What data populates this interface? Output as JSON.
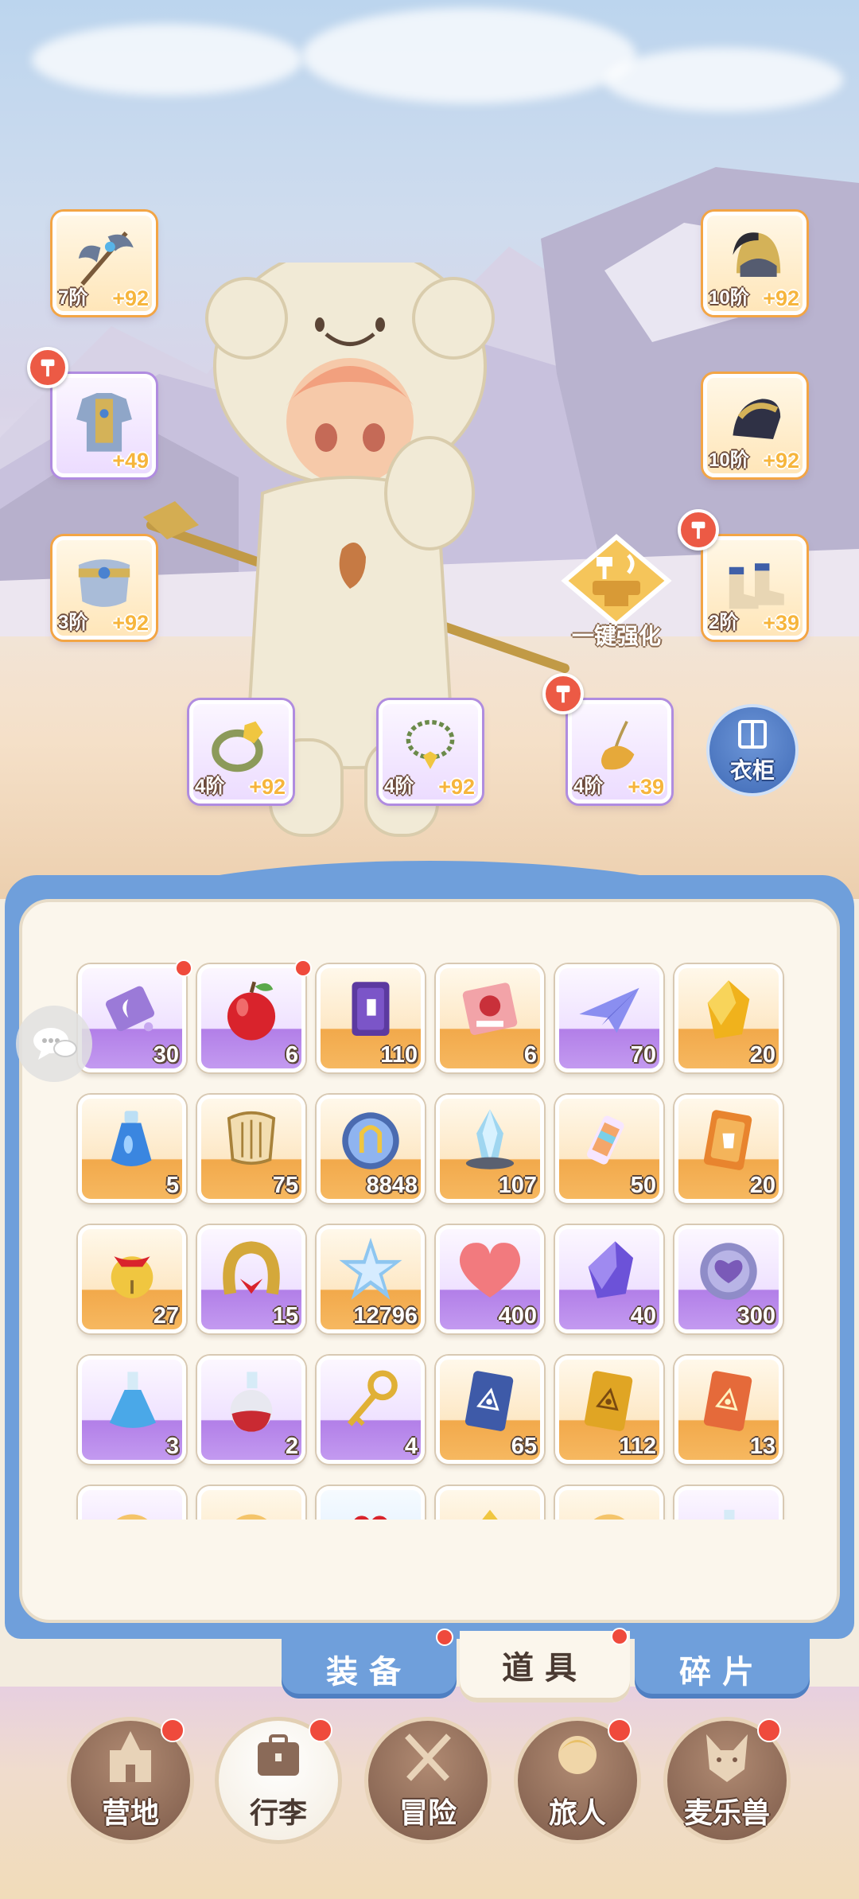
{
  "equipment": {
    "weapon": {
      "tier": "7阶",
      "bonus": "+92",
      "icon": "axe-icon"
    },
    "armor": {
      "tier": "",
      "bonus": "+49",
      "icon": "armor-icon"
    },
    "belt": {
      "tier": "3阶",
      "bonus": "+92",
      "icon": "belt-icon"
    },
    "helmet": {
      "tier": "10阶",
      "bonus": "+92",
      "icon": "helmet-icon"
    },
    "gloves": {
      "tier": "10阶",
      "bonus": "+92",
      "icon": "gauntlet-icon"
    },
    "boots": {
      "tier": "2阶",
      "bonus": "+39",
      "icon": "boots-icon"
    },
    "ring": {
      "tier": "4阶",
      "bonus": "+92",
      "icon": "ring-icon"
    },
    "necklace": {
      "tier": "4阶",
      "bonus": "+92",
      "icon": "necklace-icon"
    },
    "earring": {
      "tier": "4阶",
      "bonus": "+39",
      "icon": "earring-icon"
    }
  },
  "actions": {
    "upgrade_all": "一键强化",
    "wardrobe": "衣柜"
  },
  "inventory": {
    "rows": [
      [
        {
          "count": "30",
          "icon": "ticket-icon"
        },
        {
          "count": "6",
          "icon": "apple-icon"
        },
        {
          "count": "110",
          "icon": "purple-card-icon"
        },
        {
          "count": "6",
          "icon": "coupon-icon"
        },
        {
          "count": "70",
          "icon": "paper-plane-icon"
        },
        {
          "count": "20",
          "icon": "gold-gem-icon"
        }
      ],
      [
        {
          "count": "5",
          "icon": "blue-potion-icon"
        },
        {
          "count": "75",
          "icon": "lyre-icon"
        },
        {
          "count": "8848",
          "icon": "crystal-orb-icon"
        },
        {
          "count": "107",
          "icon": "ice-crystal-icon"
        },
        {
          "count": "50",
          "icon": "paint-tube-icon"
        },
        {
          "count": "20",
          "icon": "orange-card-icon"
        }
      ],
      [
        {
          "count": "27",
          "icon": "bell-icon"
        },
        {
          "count": "15",
          "icon": "horseshoe-icon"
        },
        {
          "count": "12796",
          "icon": "star-crystal-icon"
        },
        {
          "count": "400",
          "icon": "heart-icon"
        },
        {
          "count": "40",
          "icon": "purple-gem-icon"
        },
        {
          "count": "300",
          "icon": "heart-coin-icon"
        }
      ],
      [
        {
          "count": "3",
          "icon": "blue-flask-icon"
        },
        {
          "count": "2",
          "icon": "red-flask-icon"
        },
        {
          "count": "4",
          "icon": "golden-key-icon"
        },
        {
          "count": "65",
          "icon": "blue-eye-card-icon"
        },
        {
          "count": "112",
          "icon": "gold-eye-card-icon"
        },
        {
          "count": "13",
          "icon": "red-eye-card-icon"
        }
      ]
    ]
  },
  "category_tabs": [
    "装备",
    "道具",
    "碎片"
  ],
  "active_category": "道具",
  "bottom_nav": [
    "营地",
    "行李",
    "冒险",
    "旅人",
    "麦乐兽"
  ],
  "active_nav": "行李",
  "colors": {
    "panel_blue": "#6f9fdb",
    "rarity_orange": "#f2a94b",
    "rarity_purple": "#b27fe8",
    "badge_red": "#ef4a3c",
    "bonus_gold": "#f6b53c"
  }
}
